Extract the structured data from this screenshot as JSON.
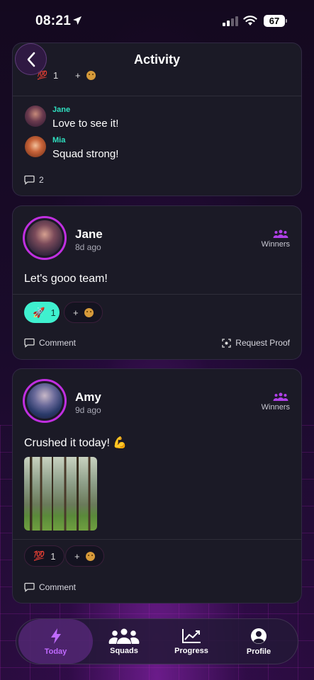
{
  "status_bar": {
    "time": "08:21",
    "battery": "67"
  },
  "header": {
    "title": "Activity"
  },
  "card1": {
    "reaction_count": "1",
    "add_reaction": "+",
    "comments": [
      {
        "name": "Jane",
        "text": "Love to see it!"
      },
      {
        "name": "Mia",
        "text": "Squad strong!"
      }
    ],
    "comment_count": "2"
  },
  "post_jane": {
    "name": "Jane",
    "time": "8d ago",
    "squad": "Winners",
    "text": "Let's gooo team!",
    "reaction_count": "1",
    "add_reaction": "+",
    "comment_label": "Comment",
    "request_proof_label": "Request Proof"
  },
  "post_amy": {
    "name": "Amy",
    "time": "9d ago",
    "squad": "Winners",
    "text": "Crushed it today! 💪",
    "reaction_emoji": "💯",
    "reaction_count": "1",
    "add_reaction": "+",
    "comment_label": "Comment"
  },
  "tabs": [
    {
      "label": "Today",
      "icon": "lightning-icon",
      "active": true
    },
    {
      "label": "Squads",
      "icon": "group-icon"
    },
    {
      "label": "Progress",
      "icon": "chart-icon"
    },
    {
      "label": "Profile",
      "icon": "profile-icon"
    }
  ],
  "colors": {
    "accent": "#c02fe0",
    "teal": "#3ff0cf",
    "card": "#1b1a26"
  }
}
